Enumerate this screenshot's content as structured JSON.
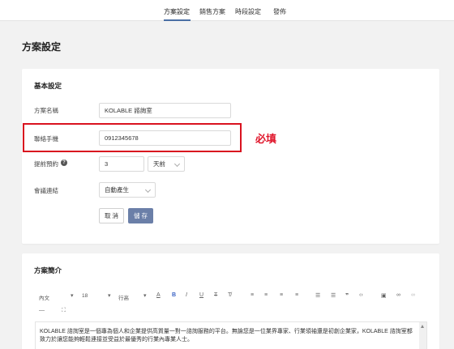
{
  "nav": {
    "tabs": [
      {
        "label": "方案設定"
      },
      {
        "label": "銷售方案"
      },
      {
        "label": "時段設定"
      },
      {
        "label": "發佈"
      }
    ]
  },
  "page_title": "方案設定",
  "basic": {
    "title": "基本設定",
    "plan_name_label": "方案名稱",
    "plan_name_value": "KOLABLE 諮詢室",
    "phone_label": "聯絡手機",
    "phone_value": "0912345678",
    "advance_label": "提前預約",
    "advance_value": "3",
    "advance_unit": "天前",
    "meeting_label": "會議連結",
    "meeting_value": "自動產生",
    "cancel_label": "取 消",
    "save_label": "儲 存"
  },
  "annotation": {
    "required_text": "必填",
    "color": "#d9121f"
  },
  "intro": {
    "title": "方案簡介",
    "toolbar": {
      "paragraph": "內文",
      "font_size": "18",
      "line_height": "行高"
    },
    "content": "KOLABLE 諮詢室是一個專為個人和企業提供高質量一對一諮詢服務的平台。無論您是一位業界專家、行業領袖還是初創企業家，KOLABLE 諮詢室都致力於讓您能夠輕鬆連接並受益於最優秀的行業內專業人士。"
  },
  "colors": {
    "accent": "#4a6fa5",
    "save_button": "#6b7fa8"
  }
}
